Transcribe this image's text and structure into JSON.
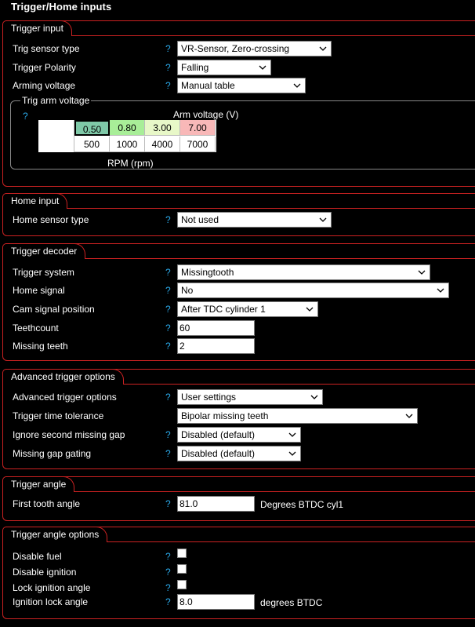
{
  "page_title": "Trigger/Home inputs",
  "help_mark": "?",
  "sections": {
    "trigger_input": {
      "title": "Trigger input",
      "trig_sensor_type": {
        "label": "Trig sensor type",
        "value": "VR-Sensor, Zero-crossing"
      },
      "trigger_polarity": {
        "label": "Trigger Polarity",
        "value": "Falling"
      },
      "arming_voltage": {
        "label": "Arming voltage",
        "value": "Manual table"
      },
      "trig_arm_voltage": {
        "title": "Trig arm voltage",
        "y_label": "Arm voltage (V)",
        "x_label": "RPM (rpm)",
        "voltages": [
          "0.50",
          "0.80",
          "3.00",
          "7.00"
        ],
        "rpms": [
          "500",
          "1000",
          "4000",
          "7000"
        ],
        "cell_colors": [
          "#7fc9a8",
          "#a8ee98",
          "#e8f8c8",
          "#f8b8b8"
        ],
        "selected_index": 0
      }
    },
    "home_input": {
      "title": "Home input",
      "home_sensor_type": {
        "label": "Home sensor type",
        "value": "Not used"
      }
    },
    "trigger_decoder": {
      "title": "Trigger decoder",
      "trigger_system": {
        "label": "Trigger system",
        "value": "Missingtooth"
      },
      "home_signal": {
        "label": "Home signal",
        "value": "No"
      },
      "cam_signal_position": {
        "label": "Cam signal position",
        "value": "After TDC cylinder 1"
      },
      "teethcount": {
        "label": "Teethcount",
        "value": "60"
      },
      "missing_teeth": {
        "label": "Missing teeth",
        "value": "2"
      }
    },
    "advanced_trigger_options": {
      "title": "Advanced trigger options",
      "advanced_trigger_options": {
        "label": "Advanced trigger options",
        "value": "User settings"
      },
      "trigger_time_tolerance": {
        "label": "Trigger time tolerance",
        "value": "Bipolar missing teeth"
      },
      "ignore_second_missing_gap": {
        "label": "Ignore second missing gap",
        "value": "Disabled (default)"
      },
      "missing_gap_gating": {
        "label": "Missing gap gating",
        "value": "Disabled (default)"
      }
    },
    "trigger_angle": {
      "title": "Trigger angle",
      "first_tooth_angle": {
        "label": "First tooth angle",
        "value": "81.0",
        "unit": "Degrees BTDC cyl1"
      }
    },
    "trigger_angle_options": {
      "title": "Trigger angle options",
      "disable_fuel": {
        "label": "Disable fuel",
        "checked": false
      },
      "disable_ignition": {
        "label": "Disable ignition",
        "checked": false
      },
      "lock_ignition_angle": {
        "label": "Lock ignition angle",
        "checked": false
      },
      "ignition_lock_angle": {
        "label": "Ignition lock angle",
        "value": "8.0",
        "unit": "degrees BTDC"
      }
    }
  }
}
